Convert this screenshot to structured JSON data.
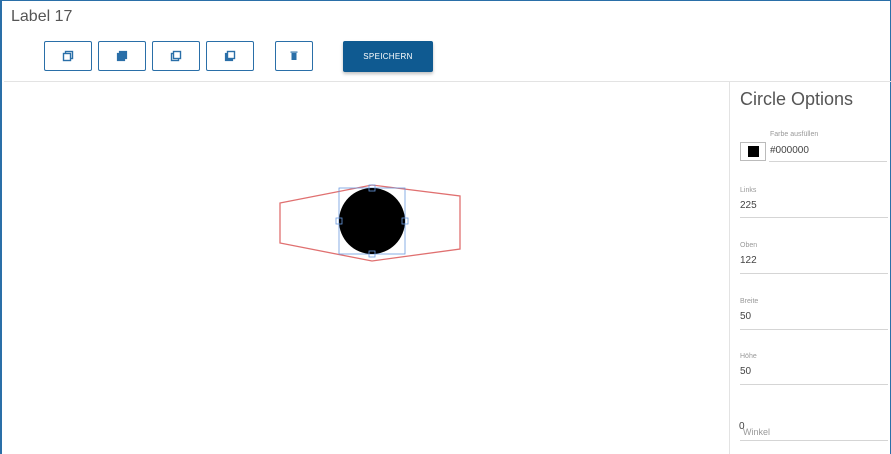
{
  "title": "Label 17",
  "toolbar": {
    "buttons": [
      {
        "name": "bring-forward-icon"
      },
      {
        "name": "bring-to-front-icon"
      },
      {
        "name": "send-backward-icon"
      },
      {
        "name": "send-to-back-icon"
      },
      {
        "name": "delete-icon"
      }
    ],
    "save_label": "SPEICHERN"
  },
  "canvas": {
    "shape": "circle",
    "fill": "#000000",
    "selection_color": "#e07070",
    "handle_color": "#6b9be0"
  },
  "panel": {
    "title": "Circle Options",
    "fill_label": "Farbe ausfüllen",
    "fill_value": "#000000",
    "fields": [
      {
        "label": "Links",
        "value": "225"
      },
      {
        "label": "Oben",
        "value": "122"
      },
      {
        "label": "Breite",
        "value": "50"
      },
      {
        "label": "Höhe",
        "value": "50"
      }
    ],
    "angle": {
      "label": "Winkel",
      "value": "0"
    }
  }
}
